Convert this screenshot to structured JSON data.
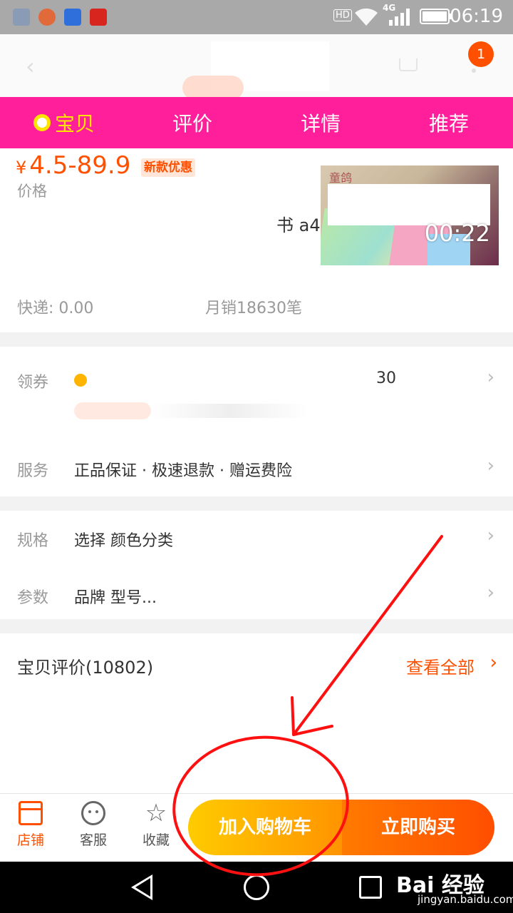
{
  "status_bar": {
    "time": "06:19",
    "network": "4G",
    "hd_label": "HD",
    "app_icon_colors": [
      "#8a9bb5",
      "#e06a3a",
      "#2f6fdc",
      "#d8261e"
    ]
  },
  "top_nav": {
    "notification_badge": "1"
  },
  "tabs": [
    {
      "label": "宝贝",
      "active": true
    },
    {
      "label": "评价",
      "active": false
    },
    {
      "label": "详情",
      "active": false
    },
    {
      "label": "推荐",
      "active": false
    }
  ],
  "product": {
    "currency": "¥",
    "price_range": "4.5-89.9",
    "promo_tag": "新款优惠",
    "original_price_label": "价格",
    "title_fragment": "书 a4",
    "video_logo": "童鸽",
    "video_duration": "00:22",
    "shipping": "快递: 0.00",
    "monthly_sales": "月销18630笔"
  },
  "rows": {
    "coupon": {
      "label": "领券",
      "amount": "30"
    },
    "service": {
      "label": "服务",
      "value": "正品保证 · 极速退款 · 赠运费险"
    },
    "spec": {
      "label": "规格",
      "value": "选择 颜色分类"
    },
    "params": {
      "label": "参数",
      "value": "品牌 型号..."
    }
  },
  "reviews": {
    "title": "宝贝评价(10802)",
    "view_all": "查看全部"
  },
  "action_bar": {
    "shop": "店铺",
    "service": "客服",
    "favorite": "收藏",
    "add_to_cart": "加入购物车",
    "buy_now": "立即购买"
  },
  "watermark": {
    "main": "Bai 经验",
    "sub": "jingyan.baidu.com"
  },
  "colors": {
    "accent": "#ff5000",
    "tab_bar": "#ff1f9b",
    "tab_active": "#ffe400",
    "annotation": "#ff1010"
  }
}
